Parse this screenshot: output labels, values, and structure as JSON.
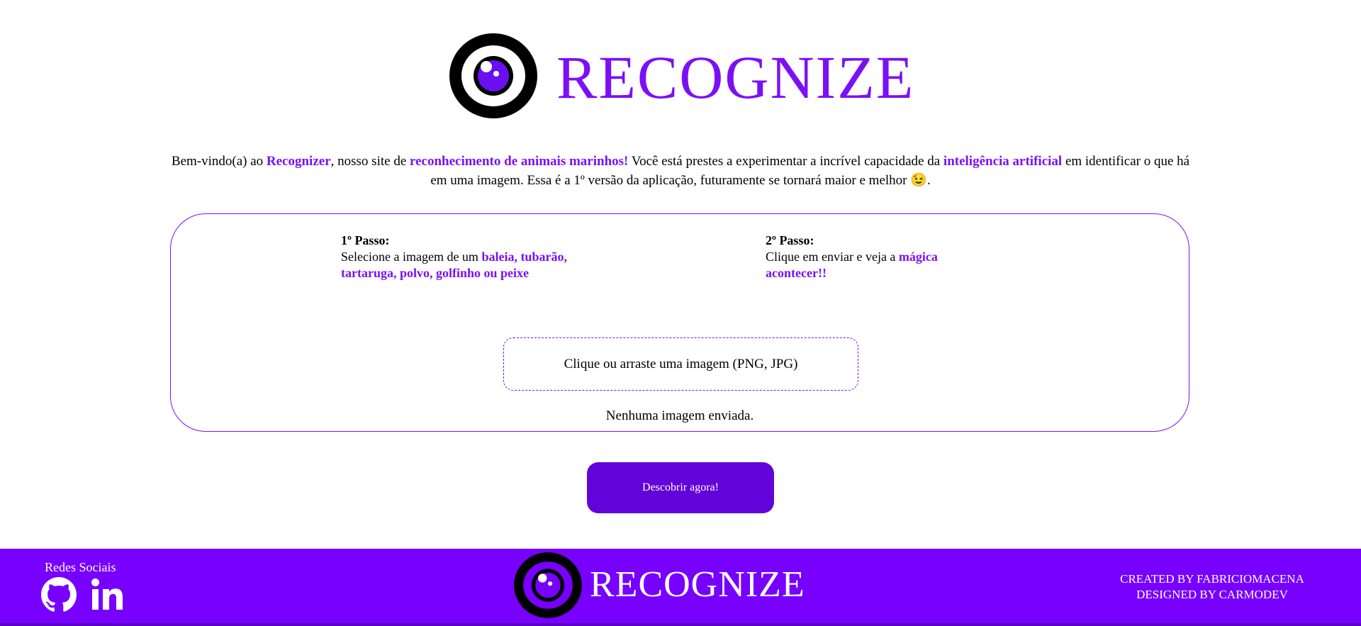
{
  "header": {
    "brand": "RECOGNIZE"
  },
  "intro": {
    "part1": "Bem-vindo(a) ao ",
    "hl1": "Recognizer",
    "part2": ", nosso site de ",
    "hl2": "reconhecimento de animais marinhos!",
    "part3": " Você está prestes a experimentar a incrível capacidade da ",
    "hl3": "inteligência artificial",
    "part4": " em identificar o que há em uma imagem. Essa é a 1º versão da aplicação, futuramente se tornará maior e melhor ",
    "emoji": "😉",
    "part5": "."
  },
  "steps": {
    "step1": {
      "title": "1º Passo:",
      "text": "Selecione a imagem de um ",
      "highlight": "baleia, tubarão, tartaruga, polvo, golfinho ou peixe"
    },
    "step2": {
      "title": "2º Passo:",
      "text": "Clique em enviar e veja a ",
      "highlight": "mágica acontecer!!"
    }
  },
  "upload": {
    "dropzone_label": "Clique ou arraste uma imagem (PNG, JPG)",
    "status": "Nenhuma imagem enviada."
  },
  "actions": {
    "submit_label": "Descobrir agora!"
  },
  "footer": {
    "social_title": "Redes Sociais",
    "social_icons": [
      "github-icon",
      "linkedin-icon"
    ],
    "brand": "RECOGNIZE",
    "credit1": "CREATED BY FABRICIOMACENA",
    "credit2": "DESIGNED BY CARMODEV"
  },
  "colors": {
    "accent": "#7b10f5",
    "button": "#6203d9",
    "footer": "#7700ff"
  }
}
